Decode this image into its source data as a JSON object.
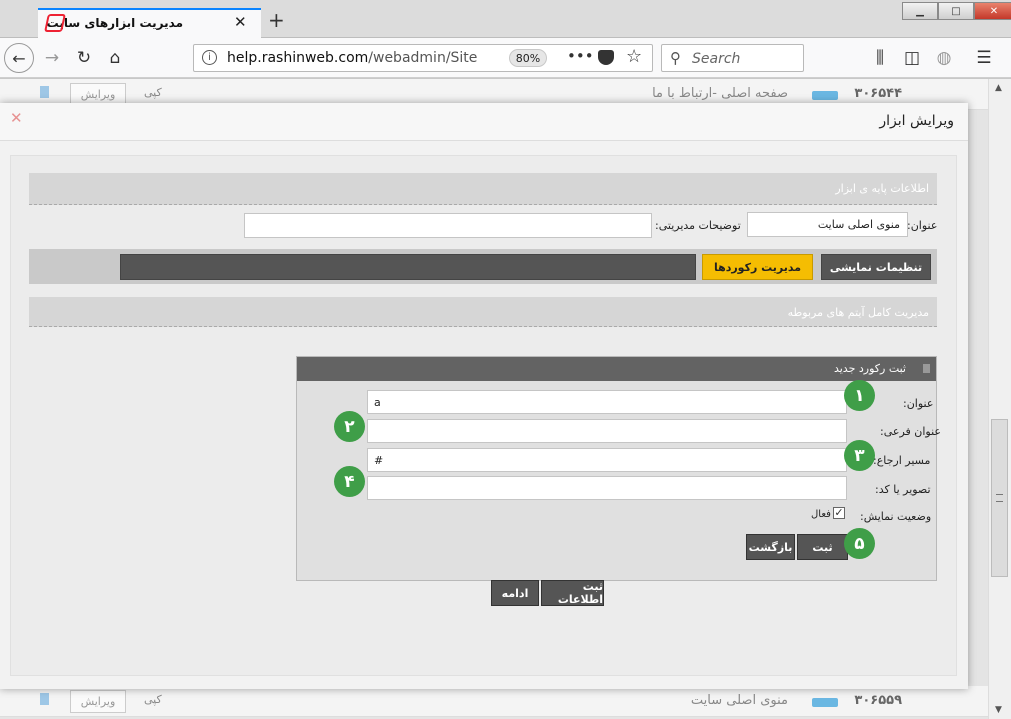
{
  "browser": {
    "tab_title": "مدیریت ابزارهای سایت",
    "tab_close": "✕",
    "new_tab": "+",
    "url_domain": "help.rashinweb.com",
    "url_path": "/webadmin/Site_gadg",
    "zoom": "80%",
    "search_placeholder": "Search"
  },
  "background_rows": [
    {
      "number": "۳۰۶۵۴۴",
      "title": "صفحه اصلی -ارتباط با ما",
      "copy": "کپی",
      "edit": "ویرایش"
    },
    {
      "number": "۳۰۶۵۵۹",
      "title": "منوی اصلی سایت",
      "copy": "کپی",
      "edit": "ویرایش"
    }
  ],
  "modal": {
    "title": "ویرایش ابزار",
    "close": "✕",
    "base_info_header": "اطلاعات پایه ی ابزار",
    "title_label": "عنوان:",
    "title_value": "منوی اصلی سایت",
    "admin_notes_label": "توضیحات مدیریتی:",
    "admin_notes_value": "",
    "tabs": {
      "display_settings": "تنظیمات نمایشی",
      "records_management": "مدیریت رکوردها"
    },
    "related_items_header": "مدیریت کامل آیتم های مربوطه",
    "new_record": {
      "header": "ثبت رکورد جدید",
      "fields": [
        {
          "label": "عنوان:",
          "value": "a"
        },
        {
          "label": "عنوان فرعی:",
          "value": ""
        },
        {
          "label": "مسیر ارجاع:",
          "value": "#"
        },
        {
          "label": "تصویر یا کد:",
          "value": ""
        }
      ],
      "status_label": "وضعیت نمایش:",
      "active_label": "فعال",
      "active_checked": "✓",
      "save_button": "ثبت",
      "back_button": "بازگشت"
    },
    "submit_button": "ثبت اطلاعات",
    "continue_button": "ادامه"
  },
  "step_badges": [
    "۱",
    "۲",
    "۳",
    "۴",
    "۵"
  ],
  "colors": {
    "accent_tab": "#f5bd02",
    "dark_button": "#555555",
    "badge_green": "#3f9e48"
  }
}
